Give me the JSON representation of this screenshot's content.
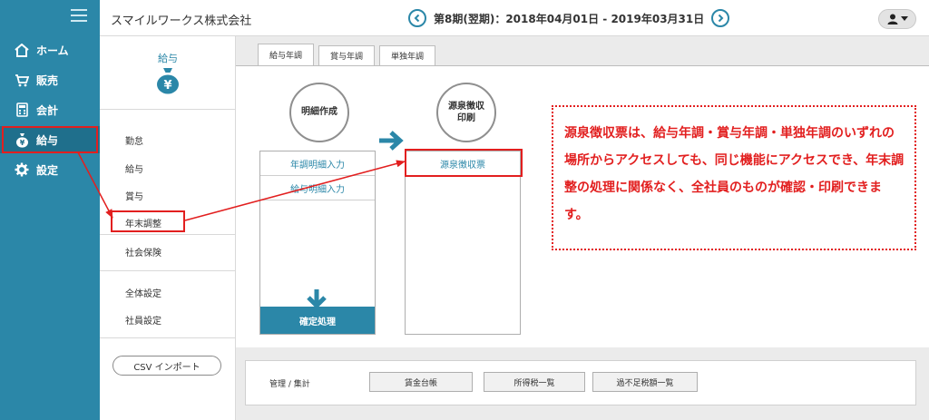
{
  "header": {
    "company": "スマイルワークス株式会社",
    "period": "第8期(翌期)：2018年04月01日 - 2019年03月31日"
  },
  "nav": {
    "items": [
      {
        "label": "ホーム",
        "icon": "home-icon"
      },
      {
        "label": "販売",
        "icon": "cart-icon"
      },
      {
        "label": "会計",
        "icon": "calculator-icon"
      },
      {
        "label": "給与",
        "icon": "money-bag-icon"
      },
      {
        "label": "設定",
        "icon": "gear-icon"
      }
    ],
    "active": "給与"
  },
  "sidebar": {
    "title": "給与",
    "items": [
      "勤怠",
      "給与",
      "賞与",
      "年末調整",
      "社会保険",
      "全体設定",
      "社員設定"
    ],
    "highlighted": "年末調整",
    "csv_button": "CSV インポート"
  },
  "tabs": [
    {
      "label": "給与年調",
      "active": true
    },
    {
      "label": "賞与年調",
      "active": false
    },
    {
      "label": "単独年調",
      "active": false
    }
  ],
  "flow": {
    "step1": "明細作成",
    "step2_line1": "源泉徴収",
    "step2_line2": "印刷",
    "col1_buttons": [
      "年調明細入力",
      "給与明細入力"
    ],
    "confirm": "確定処理",
    "col2_buttons": [
      "源泉徴収票"
    ]
  },
  "callout": {
    "text": "源泉徴収票は、給与年調・賞与年調・単独年調のいずれの場所からアクセスしても、同じ機能にアクセスでき、年末調整の処理に関係なく、全社員のものが確認・印刷できます。"
  },
  "bottom": {
    "label": "管理 / 集計",
    "buttons": [
      "賃金台帳",
      "所得税一覧",
      "過不足税額一覧"
    ]
  },
  "colors": {
    "accent": "#2b87a8",
    "annotation": "#e21f1f"
  }
}
